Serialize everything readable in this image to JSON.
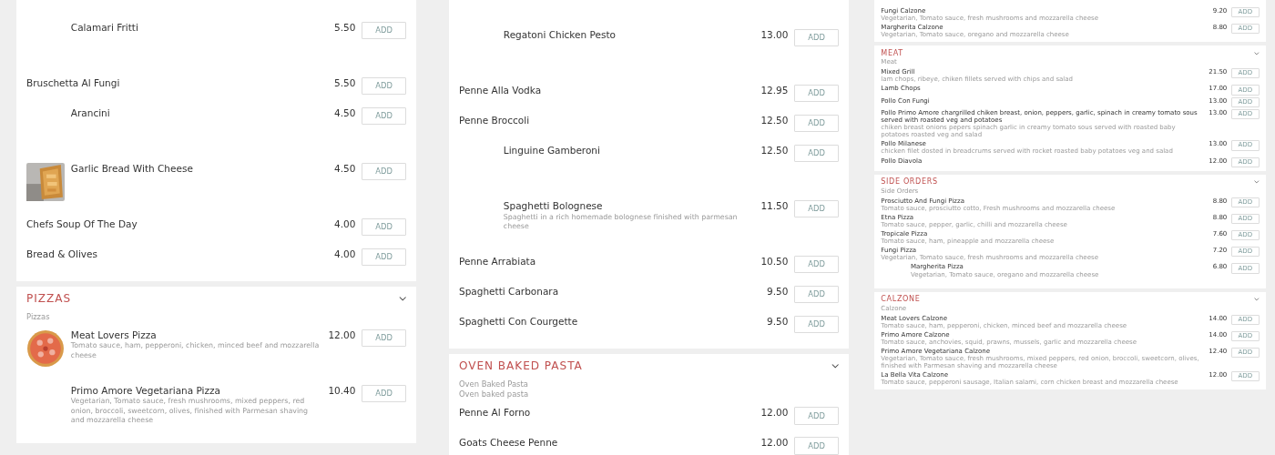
{
  "panes": [
    {
      "blocks": [
        {
          "items": [
            {
              "kind": "spacer",
              "name": "Calamari Fritti",
              "price": "5.50",
              "button": "ADD"
            },
            {
              "kind": "plain",
              "name": "Bruschetta Al Fungi",
              "price": "5.50",
              "button": "ADD"
            },
            {
              "kind": "spacer",
              "name": "Arancini",
              "price": "4.50",
              "button": "ADD"
            },
            {
              "name": "Garlic Bread With Cheese",
              "price": "4.50",
              "button": "ADD"
            },
            {
              "kind": "plain",
              "name": "Chefs Soup Of The Day",
              "price": "4.00",
              "button": "ADD"
            },
            {
              "kind": "plain",
              "name": "Bread & Olives",
              "price": "4.00",
              "button": "ADD"
            }
          ]
        },
        {
          "title": "PIZZAS",
          "subtitles": [
            "Pizzas"
          ],
          "items": [
            {
              "name": "Meat Lovers Pizza",
              "description": "Tomato sauce, ham, pepperoni, chicken, minced beef and mozzarella cheese",
              "price": "12.00",
              "button": "ADD"
            },
            {
              "kind": "spacer",
              "name": "Primo Amore Vegetariana Pizza",
              "description": "Vegetarian, Tomato sauce, fresh mushrooms, mixed peppers, red onion, broccoli, sweetcorn, olives, finished with Parmesan shaving and mozzarella cheese",
              "price": "10.40",
              "button": "ADD"
            }
          ]
        }
      ]
    },
    {
      "blocks": [
        {
          "items": [
            {
              "kind": "spacer",
              "name": "Regatoni Chicken Pesto",
              "price": "13.00",
              "button": "ADD"
            },
            {
              "kind": "plain",
              "name": "Penne Alla Vodka",
              "price": "12.95",
              "button": "ADD"
            },
            {
              "kind": "plain",
              "name": "Penne Broccoli",
              "price": "12.50",
              "button": "ADD"
            },
            {
              "kind": "spacer",
              "name": "Linguine Gamberoni",
              "price": "12.50",
              "button": "ADD"
            },
            {
              "kind": "spacer",
              "name": "Spaghetti Bolognese",
              "description": "Spaghetti in a rich homemade bolognese finished with parmesan cheese",
              "price": "11.50",
              "button": "ADD"
            },
            {
              "kind": "plain",
              "name": "Penne Arrabiata",
              "price": "10.50",
              "button": "ADD"
            },
            {
              "kind": "plain",
              "name": "Spaghetti Carbonara",
              "price": "9.50",
              "button": "ADD"
            },
            {
              "kind": "plain",
              "name": "Spaghetti Con Courgette",
              "price": "9.50",
              "button": "ADD"
            }
          ]
        },
        {
          "title": "OVEN BAKED PASTA",
          "subtitles": [
            "Oven Baked Pasta",
            "Oven baked pasta"
          ],
          "items": [
            {
              "kind": "plain",
              "name": "Penne Al Forno",
              "price": "12.00",
              "button": "ADD"
            },
            {
              "kind": "plain",
              "name": "Goats Cheese Penne",
              "price": "12.00",
              "button": "ADD"
            }
          ]
        }
      ]
    },
    {
      "blocks": [
        {
          "items": [
            {
              "kind": "plain",
              "name": "Fungi Calzone",
              "description": "Vegetarian, Tomato sauce, fresh mushrooms and mozzarella cheese",
              "price": "9.20",
              "button": "ADD"
            },
            {
              "kind": "plain",
              "name": "Margherita Calzone",
              "description": "Vegetarian, Tomato sauce, oregano and mozzarella cheese",
              "price": "8.80",
              "button": "ADD"
            }
          ]
        },
        {
          "title": "MEAT",
          "subtitles": [
            "Meat"
          ],
          "items": [
            {
              "kind": "plain",
              "name": "Mixed Grill",
              "description": "lam chops, ribeye, chiken fillets served with chips and salad",
              "price": "21.50",
              "button": "ADD"
            },
            {
              "kind": "plain",
              "name": "Lamb Chops",
              "price": "17.00",
              "button": "ADD"
            },
            {
              "kind": "plain",
              "name": "Pollo Con Fungi",
              "price": "13.00",
              "button": "ADD"
            },
            {
              "kind": "plain",
              "name": "Pollo Primo Amore chargrilled chiken breast, onion, peppers, garlic, spinach in creamy tomato sous served with roasted veg and potatoes",
              "description": "chiken breast onions pepers spinach garlic in creamy tomato sous served with roasted baby potatoes roasted veg and salad",
              "price": "13.00",
              "button": "ADD"
            },
            {
              "kind": "plain",
              "name": "Pollo Milanese",
              "description": "chicken filet dosted in breadcrums served with rocket roasted baby potatoes veg and salad",
              "price": "13.00",
              "button": "ADD"
            },
            {
              "kind": "plain",
              "name": "Pollo Diavola",
              "price": "12.00",
              "button": "ADD"
            }
          ]
        },
        {
          "title": "SIDE ORDERS",
          "subtitles": [
            "Side Orders"
          ],
          "items": [
            {
              "kind": "plain",
              "name": "Prosciutto And Fungi Pizza",
              "description": "Tomato sauce, prosciutto cotto, Fresh mushrooms and mozzarella cheese",
              "price": "8.80",
              "button": "ADD"
            },
            {
              "kind": "plain",
              "name": "Etna Pizza",
              "description": "Tomato sauce, pepper, garlic, chilli and mozzarella cheese",
              "price": "8.80",
              "button": "ADD"
            },
            {
              "kind": "plain",
              "name": "Tropicale Pizza",
              "description": "Tomato sauce, ham, pineapple and mozzarella cheese",
              "price": "7.60",
              "button": "ADD"
            },
            {
              "kind": "plain",
              "name": "Fungi Pizza",
              "description": "Vegetarian, Tomato sauce, fresh mushrooms and mozzarella cheese",
              "price": "7.20",
              "button": "ADD"
            },
            {
              "kind": "spacer",
              "name": "Margherita Pizza",
              "description": "Vegetarian, Tomato sauce, oregano and mozzarella cheese",
              "price": "6.80",
              "button": "ADD"
            }
          ]
        },
        {
          "title": "CALZONE",
          "subtitles": [
            "Calzone"
          ],
          "items": [
            {
              "kind": "plain",
              "name": "Meat Lovers Calzone",
              "description": "Tomato sauce, ham, pepperoni, chicken, minced beef and mozzarella cheese",
              "price": "14.00",
              "button": "ADD"
            },
            {
              "kind": "plain",
              "name": "Primo Amore Calzone",
              "description": "Tomato sauce, anchovies, squid, prawns, mussels, garlic and mozzarella cheese",
              "price": "14.00",
              "button": "ADD"
            },
            {
              "kind": "plain",
              "name": "Primo Amore Vegetariana Calzone",
              "description": "Vegetarian, Tomato sauce, fresh mushrooms, mixed peppers, red onion, broccoli, sweetcorn, olives, finished with Parmesan shaving and mozzarella cheese",
              "price": "12.40",
              "button": "ADD"
            },
            {
              "kind": "plain",
              "name": "La Bella Vita Calzone",
              "description": "Tomato sauce, pepperoni sausage, Italian salami, corn chicken breast and mozzarella cheese",
              "price": "12.00",
              "button": "ADD"
            }
          ]
        }
      ]
    }
  ]
}
